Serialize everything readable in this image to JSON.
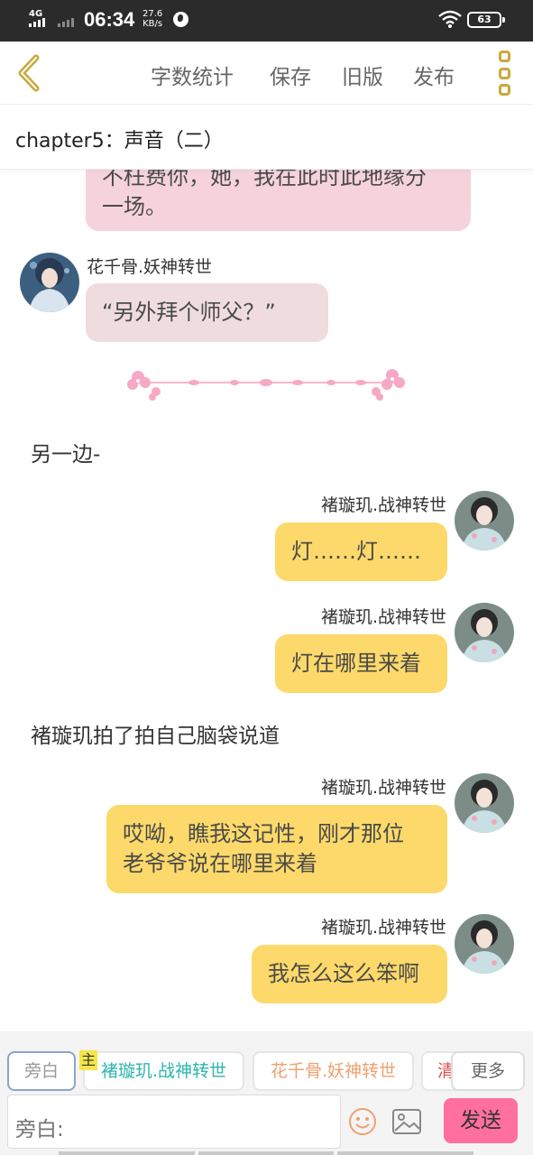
{
  "status_bar": {
    "network": "4G",
    "time": "06:34",
    "speed_value": "27.6",
    "speed_unit": "KB/s",
    "battery": "63"
  },
  "nav": {
    "word_count": "字数统计",
    "save": "保存",
    "old_version": "旧版",
    "publish": "发布"
  },
  "chapter": {
    "title": "chapter5：声音（二）"
  },
  "messages": [
    {
      "type": "bubble",
      "side": "left",
      "color": "pink",
      "lines": [
        "不枉费你，她，我在此时此地缘分",
        "一场。"
      ]
    },
    {
      "type": "bubble",
      "side": "left",
      "sender": "花千骨.妖神转世",
      "color": "gray",
      "lines": [
        "“另外拜个师父？”"
      ]
    },
    {
      "type": "narration",
      "text": "另一边-"
    },
    {
      "type": "bubble",
      "side": "right",
      "sender": "褚璇玑.战神转世",
      "color": "yellow",
      "lines": [
        "灯……灯……"
      ]
    },
    {
      "type": "bubble",
      "side": "right",
      "sender": "褚璇玑.战神转世",
      "color": "yellow",
      "lines": [
        "灯在哪里来着"
      ]
    },
    {
      "type": "narration",
      "text": "褚璇玑拍了拍自己脑袋说道"
    },
    {
      "type": "bubble",
      "side": "right",
      "sender": "褚璇玑.战神转世",
      "color": "yellow",
      "lines": [
        "哎呦，瞧我这记性，刚才那位",
        "老爷爷说在哪里来着"
      ]
    },
    {
      "type": "bubble",
      "side": "right",
      "sender": "褚璇玑.战神转世",
      "color": "yellow",
      "lines": [
        "我怎么这么笨啊"
      ]
    }
  ],
  "bottom": {
    "tabs": [
      "旁白",
      "褚璇玑.战神转世",
      "花千骨.妖神转世",
      "清"
    ],
    "main_badge": "主",
    "more": "更多",
    "input_placeholder": "旁白:",
    "send": "发送"
  },
  "colors": {
    "accent_pink": "#ff6fa0",
    "bubble_yellow": "#fcd96a",
    "bubble_pink": "#f6d3dc",
    "nav_icon_gold": "#c9a93a",
    "tab_teal": "#2bb5b0",
    "tab_orange": "#f0a070",
    "tab_red": "#e05050"
  }
}
